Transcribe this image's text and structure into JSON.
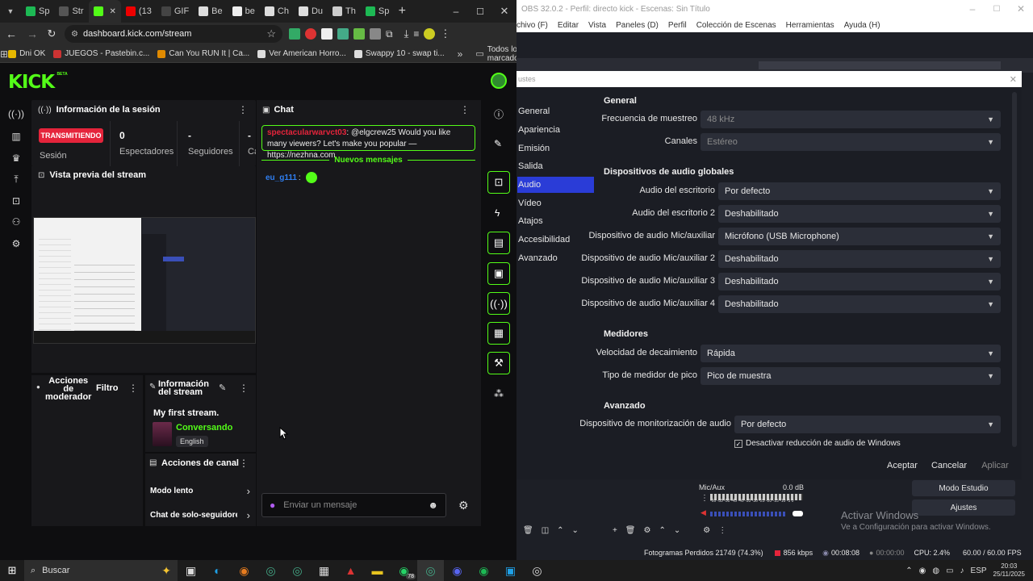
{
  "chrome": {
    "tabs": [
      "Sp",
      "Str",
      "",
      "(13",
      "GIF",
      "Be",
      "be",
      "Ch",
      "Du",
      "Th",
      "Sp"
    ],
    "url": "dashboard.kick.com/stream",
    "bookmarks": [
      "Dni OK",
      "JUEGOS - Pastebin.c...",
      "Can You RUN It | Ca...",
      "Ver American Horro...",
      "Swappy 10 - swap ti..."
    ],
    "all_bookmarks": "Todos los marcadores"
  },
  "kick": {
    "logo": "KICK",
    "logo_badge": "BETA",
    "session": {
      "title": "Información de la sesión",
      "status": "TRANSMITIENDO",
      "status_label": "Sesión",
      "viewers_value": "0",
      "viewers_label": "Espectadores",
      "followers_value": "-",
      "followers_label": "Seguidores",
      "extra_value": "-",
      "extra_label": "Ca"
    },
    "preview": {
      "title": "Vista previa del stream"
    },
    "mod": {
      "title_line1": "Acciones",
      "title_line2": "de",
      "title_line3": "moderador",
      "filter": "Filtro"
    },
    "stream_info": {
      "title_line1": "Información",
      "title_line2": "del stream",
      "stream_title": "My first stream.",
      "category": "Conversando",
      "language": "English"
    },
    "channel_actions": {
      "title": "Acciones de canal",
      "slow_mode": "Modo lento",
      "followers_chat": "Chat de solo-seguidores"
    },
    "chat": {
      "title": "Chat",
      "pinned_user": "spectacularwarvct03",
      "pinned_text": ": @elgcrew25 Would you like many viewers? Let's make you popular — https://nezhna.com",
      "new_messages": "Nuevos mensajes",
      "msg_user": "eu_g111",
      "input_placeholder": "Enviar un mensaje"
    }
  },
  "obs": {
    "window_title": "OBS 32.0.2 - Perfil: directo kick - Escenas: Sin Título",
    "menu": [
      "chivo (F)",
      "Editar",
      "Vista",
      "Paneles (D)",
      "Perfil",
      "Colección de Escenas",
      "Herramientas",
      "Ayuda (H)"
    ],
    "dialog_title": "ustes",
    "nav": [
      "General",
      "Apariencia",
      "Emisión",
      "Salida",
      "Audio",
      "Vídeo",
      "Atajos",
      "Accesibilidad",
      "Avanzado"
    ],
    "section_general": "General",
    "sample_rate_label": "Frecuencia de muestreo",
    "sample_rate_value": "48 kHz",
    "channels_label": "Canales",
    "channels_value": "Estéreo",
    "section_devices": "Dispositivos de audio globales",
    "desktop_label": "Audio del escritorio",
    "desktop_value": "Por defecto",
    "desktop2_label": "Audio del escritorio 2",
    "desktop2_value": "Deshabilitado",
    "mic_label": "Dispositivo de audio Mic/auxiliar",
    "mic_value": "Micrófono (USB Microphone)",
    "mic2_label": "Dispositivo de audio Mic/auxiliar 2",
    "mic2_value": "Deshabilitado",
    "mic3_label": "Dispositivo de audio Mic/auxiliar 3",
    "mic3_value": "Deshabilitado",
    "mic4_label": "Dispositivo de audio Mic/auxiliar 4",
    "mic4_value": "Deshabilitado",
    "section_meters": "Medidores",
    "decay_label": "Velocidad de decaimiento",
    "decay_value": "Rápida",
    "peak_label": "Tipo de medidor de pico",
    "peak_value": "Pico de muestra",
    "section_advanced": "Avanzado",
    "monitor_label": "Dispositivo de monitorización de audio",
    "monitor_value": "Por defecto",
    "ducking_label": "Desactivar reducción de audio de Windows",
    "accept": "Aceptar",
    "cancel": "Cancelar",
    "apply": "Aplicar",
    "mixer_label": "Mic/Aux",
    "mixer_db": "0.0 dB",
    "mixer_scale": "-60 -55 -50 -45 -40 -35 -30 -25 -20 -15 -10 -5 0",
    "studio_mode": "Modo Estudio",
    "settings": "Ajustes",
    "activate_title": "Activar Windows",
    "activate_sub": "Ve a Configuración para activar Windows.",
    "status_frames": "Fotogramas Perdidos 21749 (74.3%)",
    "status_kbps": "856 kbps",
    "status_live_time": "00:08:08",
    "status_rec_time": "00:00:00",
    "status_cpu": "CPU: 2.4%",
    "status_fps": "60.00 / 60.00 FPS"
  },
  "taskbar": {
    "search": "Buscar",
    "badge": "78",
    "lang": "ESP",
    "time": "20:03",
    "date": "25/11/2025"
  },
  "colors": {
    "kick_green": "#53fc18",
    "obs_accent": "#2a3cd7",
    "live_red": "#e5243b"
  }
}
